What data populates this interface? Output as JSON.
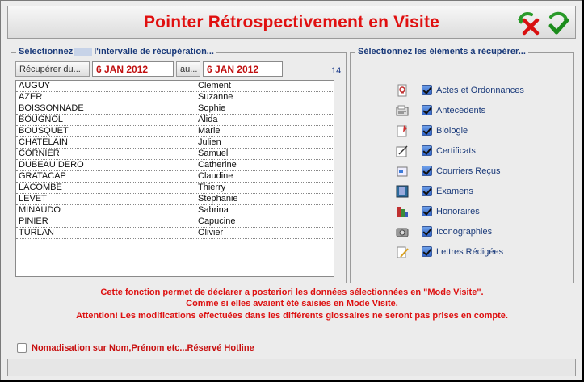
{
  "window": {
    "title": "Pointer Rétrospectivement en Visite",
    "cancel_icon": "cancel-icon",
    "validate_icon": "validate-icon"
  },
  "interval": {
    "legend_part1": "Sélectionnez",
    "legend_part2": "l'intervalle de récupération...",
    "from_button": "Récupérer du...",
    "from_date": "6 JAN 2012",
    "to_button": "au...",
    "to_date": "6 JAN 2012",
    "count": "14"
  },
  "patients": [
    {
      "nom": "AUGUY",
      "prenom": "Clement"
    },
    {
      "nom": "AZER",
      "prenom": "Suzanne"
    },
    {
      "nom": "BOISSONNADE",
      "prenom": "Sophie"
    },
    {
      "nom": "BOUGNOL",
      "prenom": "Alida"
    },
    {
      "nom": "BOUSQUET",
      "prenom": "Marie"
    },
    {
      "nom": "CHATELAIN",
      "prenom": "Julien"
    },
    {
      "nom": "CORNIER",
      "prenom": "Samuel"
    },
    {
      "nom": "DUBEAU DERO",
      "prenom": "Catherine"
    },
    {
      "nom": "GRATACAP",
      "prenom": "Claudine"
    },
    {
      "nom": "LACOMBE",
      "prenom": "Thierry"
    },
    {
      "nom": "LEVET",
      "prenom": "Stephanie"
    },
    {
      "nom": "MINAUDO",
      "prenom": "Sabrina"
    },
    {
      "nom": "PINIER",
      "prenom": "Capucine"
    },
    {
      "nom": "TURLAN",
      "prenom": "Olivier"
    }
  ],
  "elements": {
    "legend": "Sélectionnez les éléments à récupérer...",
    "items": [
      {
        "label": "Actes et Ordonnances",
        "icon": "prescription-icon",
        "checked": true
      },
      {
        "label": "Antécédents",
        "icon": "history-icon",
        "checked": true
      },
      {
        "label": "Biologie",
        "icon": "biology-icon",
        "checked": true
      },
      {
        "label": "Certificats",
        "icon": "certificate-icon",
        "checked": true
      },
      {
        "label": "Courriers Reçus",
        "icon": "mail-icon",
        "checked": true
      },
      {
        "label": "Examens",
        "icon": "exam-icon",
        "checked": true
      },
      {
        "label": "Honoraires",
        "icon": "fees-icon",
        "checked": true
      },
      {
        "label": "Iconographies",
        "icon": "camera-icon",
        "checked": true
      },
      {
        "label": "Lettres Rédigées",
        "icon": "letter-icon",
        "checked": true
      }
    ]
  },
  "info": {
    "line1": "Cette fonction permet de déclarer a posteriori  les données sélectionnées en \"Mode Visite\".",
    "line2": "Comme si elles avaient été saisies en Mode Visite.",
    "line3": "Attention! Les modifications effectuées dans les différents glossaires ne seront pas prises en compte."
  },
  "nomadisation": {
    "label": "Nomadisation sur Nom,Prénom etc...Réservé Hotline",
    "checked": false
  },
  "colors": {
    "title_red": "#e01010",
    "label_blue": "#1a3a7a",
    "warning_red": "#dd1010"
  }
}
